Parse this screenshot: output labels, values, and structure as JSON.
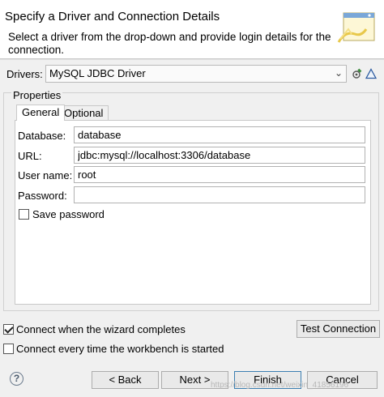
{
  "header": {
    "title": "Specify a Driver and Connection Details",
    "description": "Select a driver from the drop-down and provide login details for the connection."
  },
  "drivers": {
    "label": "Drivers:",
    "selected": "MySQL JDBC Driver",
    "edit_icon": "edit-driver-icon",
    "add_icon": "add-driver-icon"
  },
  "properties": {
    "group_label": "Properties",
    "tabs": [
      {
        "label": "General",
        "active": true
      },
      {
        "label": "Optional",
        "active": false
      }
    ],
    "fields": {
      "database": {
        "label": "Database:",
        "value": "database"
      },
      "url": {
        "label": "URL:",
        "value": "jdbc:mysql://localhost:3306/database"
      },
      "username": {
        "label": "User name:",
        "value": "root"
      },
      "password": {
        "label": "Password:",
        "value": ""
      }
    },
    "save_password": {
      "label": "Save password",
      "checked": false
    }
  },
  "options": {
    "connect_wizard": {
      "label": "Connect when the wizard completes",
      "checked": true
    },
    "connect_every_time": {
      "label": "Connect every time the workbench is started",
      "checked": false
    },
    "test_connection_label": "Test Connection"
  },
  "footer": {
    "back_label": "< Back",
    "next_label": "Next >",
    "finish_label": "Finish",
    "cancel_label": "Cancel",
    "help_symbol": "?",
    "watermark": "https://blog.csdn.net/weixin_41856196"
  },
  "colors": {
    "header_bg": "#ffffff",
    "dialog_bg": "#f0f0f0",
    "default_button_border": "#3c7fb1"
  }
}
